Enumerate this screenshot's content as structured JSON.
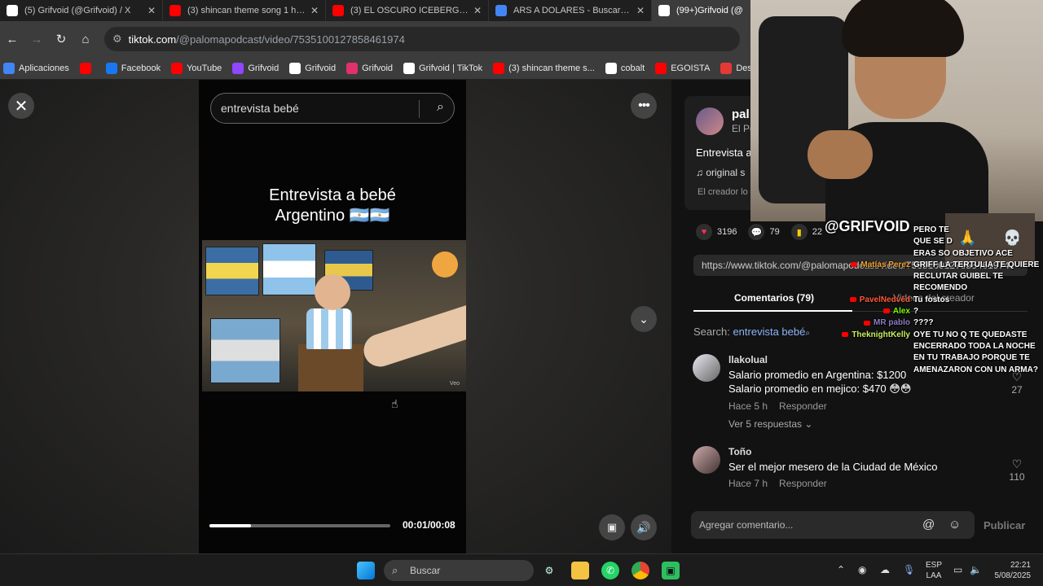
{
  "browser": {
    "tabs": [
      {
        "title": "(5) Grifvoid (@Grifvoid) / X",
        "icon": "x-logo-icon",
        "color": "#ffffff",
        "active": false
      },
      {
        "title": "(3) shincan theme song 1 hour",
        "icon": "youtube-icon",
        "color": "#ff0000",
        "active": false
      },
      {
        "title": "(3) EL OSCURO ICEBERG DE LA",
        "icon": "youtube-icon",
        "color": "#ff0000",
        "active": false
      },
      {
        "title": "ARS A DOLARES - Buscar con G",
        "icon": "google-icon",
        "color": "#4285f4",
        "active": false
      },
      {
        "title": "(99+)Grifvoid (@",
        "icon": "tiktok-icon",
        "color": "#ffffff",
        "active": true
      }
    ],
    "url_host": "tiktok.com",
    "url_path": "/@palomapodcast/video/7535100127858461974",
    "bookmarks": [
      {
        "label": "Aplicaciones",
        "icon": "apps-icon",
        "color": "#4285f4"
      },
      {
        "label": "",
        "icon": "youtube-icon",
        "color": "#ff0000"
      },
      {
        "label": "Facebook",
        "icon": "facebook-icon",
        "color": "#1877f2"
      },
      {
        "label": "YouTube",
        "icon": "youtube-icon",
        "color": "#ff0000"
      },
      {
        "label": "Grifvoid",
        "icon": "twitch-icon",
        "color": "#9146ff"
      },
      {
        "label": "Grifvoid",
        "icon": "x-logo-icon",
        "color": "#ffffff"
      },
      {
        "label": "Grifvoid",
        "icon": "instagram-icon",
        "color": "#e1306c"
      },
      {
        "label": "Grifvoid | TikTok",
        "icon": "tiktok-icon",
        "color": "#ffffff"
      },
      {
        "label": "(3) shincan theme s...",
        "icon": "youtube-icon",
        "color": "#ff0000"
      },
      {
        "label": "cobalt",
        "icon": "cobalt-icon",
        "color": "#ffffff"
      },
      {
        "label": "EGOISTA",
        "icon": "youtube-icon",
        "color": "#ff0000"
      },
      {
        "label": "Descar",
        "icon": "download-icon",
        "color": "#e53935"
      }
    ]
  },
  "video": {
    "search_value": "entrevista bebé",
    "title_line1": "Entrevista a bebé",
    "title_line2": "Argentino 🇦🇷🇦🇷",
    "watermark": "Veo",
    "time": "00:01/00:08",
    "progress": 0.23
  },
  "author": {
    "name": "pal",
    "subtitle": "El Po",
    "description": "Entrevista a",
    "music": "original s",
    "creator_note": "El creador lo"
  },
  "stats": {
    "likes": "3196",
    "comments": "79",
    "saves": "22"
  },
  "share_url": "https://www.tiktok.com/@palomapodcast/video/7535100127858461974",
  "tabs": {
    "comments_label": "Comentarios (79)",
    "videos_label": "Videos del creador"
  },
  "search_result": {
    "prefix": "Search:",
    "keyword": "entrevista bebé"
  },
  "comments": [
    {
      "user": "llakolual",
      "line1": "Salario promedio en Argentina: $1200",
      "line2": "Salario promedio en mejico: $470 😳😳",
      "time": "Hace 5 h",
      "reply": "Responder",
      "likes": "27",
      "more": "Ver 5 respuestas ⌄"
    },
    {
      "user": "Toño",
      "line1": "Ser el mejor mesero de la Ciudad de México",
      "line2": "",
      "time": "Hace 7 h",
      "reply": "Responder",
      "likes": "110",
      "more": ""
    }
  ],
  "comment_input": {
    "placeholder": "Agregar comentario...",
    "publish": "Publicar"
  },
  "stream": {
    "handle": "@GRIFVOID",
    "chat": [
      {
        "user": "",
        "color": "#ffffff",
        "msg": "PERO TE"
      },
      {
        "user": "",
        "color": "#ffffff",
        "msg": "QUE SE D"
      },
      {
        "user": "",
        "color": "#ffffff",
        "msg": "ERAS SO OBJETIVO ACE"
      },
      {
        "user": "Matías Perez",
        "color": "#f0a030",
        "msg": "GRIFF LA TERTULIA TE QUIERE RECLUTAR GUIBEL TE RECOMENDO"
      },
      {
        "user": "PavelNedvěd",
        "color": "#ff5a3c",
        "msg": "Tu fostos"
      },
      {
        "user": "Alex",
        "color": "#7cfc00",
        "msg": "?"
      },
      {
        "user": "MR pablo",
        "color": "#8e7cc3",
        "msg": "????"
      },
      {
        "user": "TheknightKelly",
        "color": "#c8f060",
        "msg": "OYE TU NO Q TE QUEDASTE ENCERRADO TODA LA NOCHE EN TU TRABAJO PORQUE TE AMENAZARON CON UN ARMA?"
      }
    ]
  },
  "taskbar": {
    "search_placeholder": "Buscar",
    "lang1": "ESP",
    "lang2": "LAA",
    "time": "22:21",
    "date": "5/08/2025"
  }
}
